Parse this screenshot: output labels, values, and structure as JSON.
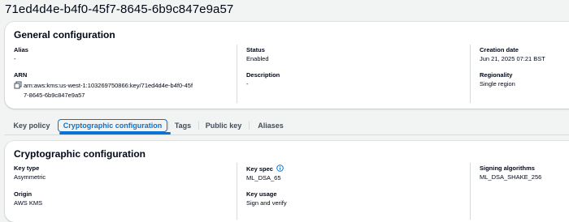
{
  "page": {
    "title": "71ed4d4e-b4f0-45f7-8645-6b9c847e9a57"
  },
  "general": {
    "title": "General configuration",
    "alias": {
      "label": "Alias",
      "value": "-"
    },
    "arn": {
      "label": "ARN",
      "value": "arn:aws:kms:us-west-1:103269750866:key/71ed4d4e-b4f0-45f7-8645-6b9c847e9a57"
    },
    "status": {
      "label": "Status",
      "value": "Enabled"
    },
    "description": {
      "label": "Description",
      "value": "-"
    },
    "creation_date": {
      "label": "Creation date",
      "value": "Jun 21, 2025 07:21 BST"
    },
    "regionality": {
      "label": "Regionality",
      "value": "Single region"
    }
  },
  "tabs": [
    {
      "label": "Key policy"
    },
    {
      "label": "Cryptographic configuration",
      "active": true
    },
    {
      "label": "Tags"
    },
    {
      "label": "Public key"
    },
    {
      "label": "Aliases"
    }
  ],
  "crypto": {
    "title": "Cryptographic configuration",
    "key_type": {
      "label": "Key type",
      "value": "Asymmetric"
    },
    "origin": {
      "label": "Origin",
      "value": "AWS KMS"
    },
    "key_spec": {
      "label": "Key spec",
      "value": "ML_DSA_65"
    },
    "key_usage": {
      "label": "Key usage",
      "value": "Sign and verify"
    },
    "signing_algorithms": {
      "label": "Signing algorithms",
      "value": "ML_DSA_SHAKE_256"
    }
  },
  "icons": {
    "copy": "copy-icon",
    "info": "info-icon"
  },
  "colors": {
    "accent": "#0972d3",
    "background": "#f2f3f3",
    "card": "#ffffff",
    "text": "#000716"
  }
}
